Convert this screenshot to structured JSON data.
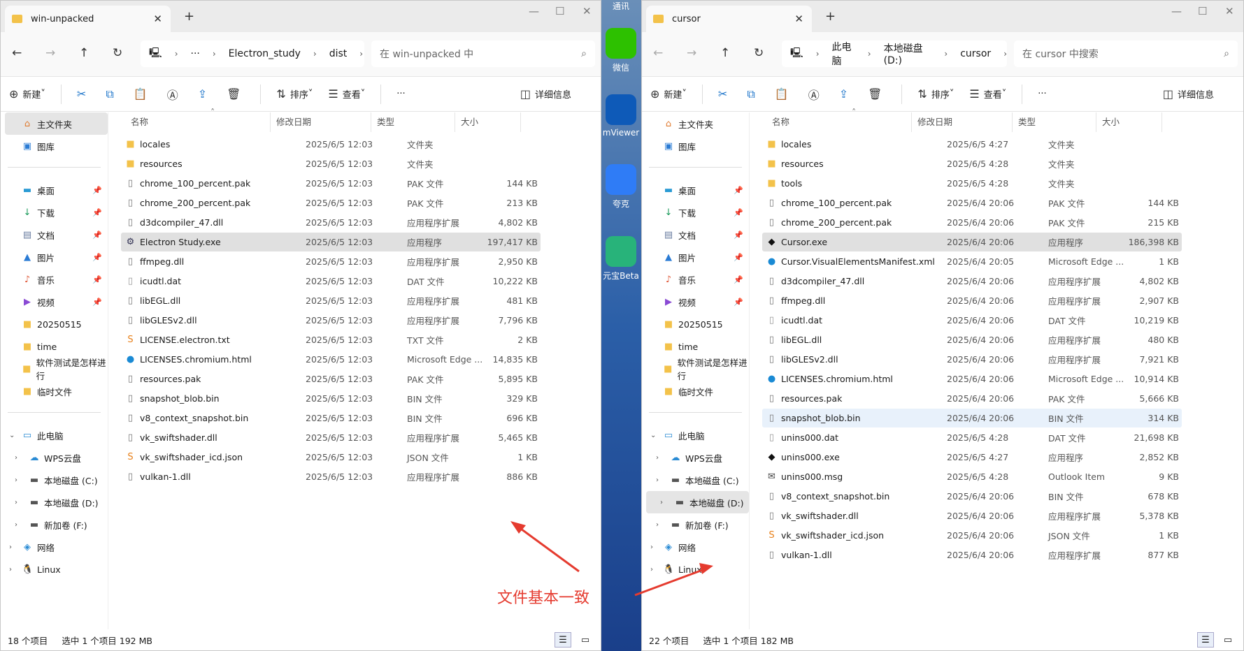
{
  "desktop": {
    "icons": [
      {
        "label": "微信",
        "name": "wechat-icon",
        "color": "#2dc100"
      },
      {
        "label": "mViewer",
        "name": "teamviewer-icon",
        "color": "#0e5ab8"
      },
      {
        "label": "夸克",
        "name": "quark-icon",
        "color": "#2f7cf6"
      },
      {
        "label": "元宝Beta",
        "name": "yuanbao-icon",
        "color": "#28b37a"
      }
    ],
    "top_text": "通讯"
  },
  "annotation": {
    "text": "文件基本一致",
    "color": "#e53b2f"
  },
  "windows": [
    {
      "tab_title": "win-unpacked",
      "breadcrumbs": [
        "···",
        "Electron_study",
        "dist",
        "win-unpacked"
      ],
      "search_placeholder": "在 win-unpacked 中",
      "selected_sidebar": "主文件夹",
      "files": [
        [
          "folder",
          "locales",
          "2025/6/5 12:03",
          "文件夹",
          ""
        ],
        [
          "folder",
          "resources",
          "2025/6/5 12:03",
          "文件夹",
          ""
        ],
        [
          "file",
          "chrome_100_percent.pak",
          "2025/6/5 12:03",
          "PAK 文件",
          "144 KB"
        ],
        [
          "file",
          "chrome_200_percent.pak",
          "2025/6/5 12:03",
          "PAK 文件",
          "213 KB"
        ],
        [
          "dll",
          "d3dcompiler_47.dll",
          "2025/6/5 12:03",
          "应用程序扩展",
          "4,802 KB"
        ],
        [
          "exe",
          "Electron Study.exe",
          "2025/6/5 12:03",
          "应用程序",
          "197,417 KB"
        ],
        [
          "dll",
          "ffmpeg.dll",
          "2025/6/5 12:03",
          "应用程序扩展",
          "2,950 KB"
        ],
        [
          "dat",
          "icudtl.dat",
          "2025/6/5 12:03",
          "DAT 文件",
          "10,222 KB"
        ],
        [
          "dll",
          "libEGL.dll",
          "2025/6/5 12:03",
          "应用程序扩展",
          "481 KB"
        ],
        [
          "dll",
          "libGLESv2.dll",
          "2025/6/5 12:03",
          "应用程序扩展",
          "7,796 KB"
        ],
        [
          "sublime",
          "LICENSE.electron.txt",
          "2025/6/5 12:03",
          "TXT 文件",
          "2 KB"
        ],
        [
          "edge",
          "LICENSES.chromium.html",
          "2025/6/5 12:03",
          "Microsoft Edge ...",
          "14,835 KB"
        ],
        [
          "file",
          "resources.pak",
          "2025/6/5 12:03",
          "PAK 文件",
          "5,895 KB"
        ],
        [
          "file",
          "snapshot_blob.bin",
          "2025/6/5 12:03",
          "BIN 文件",
          "329 KB"
        ],
        [
          "file",
          "v8_context_snapshot.bin",
          "2025/6/5 12:03",
          "BIN 文件",
          "696 KB"
        ],
        [
          "dll",
          "vk_swiftshader.dll",
          "2025/6/5 12:03",
          "应用程序扩展",
          "5,465 KB"
        ],
        [
          "sublime",
          "vk_swiftshader_icd.json",
          "2025/6/5 12:03",
          "JSON 文件",
          "1 KB"
        ],
        [
          "dll",
          "vulkan-1.dll",
          "2025/6/5 12:03",
          "应用程序扩展",
          "886 KB"
        ]
      ],
      "selected_row": 5,
      "hover_row": -1,
      "status": [
        "18 个项目",
        "选中 1 个项目  192 MB"
      ]
    },
    {
      "tab_title": "cursor",
      "breadcrumbs": [
        "此电脑",
        "本地磁盘 (D:)",
        "cursor"
      ],
      "search_placeholder": "在 cursor 中搜索",
      "selected_sidebar": "本地磁盘 (D:)",
      "files": [
        [
          "folder",
          "locales",
          "2025/6/5 4:27",
          "文件夹",
          ""
        ],
        [
          "folder",
          "resources",
          "2025/6/5 4:28",
          "文件夹",
          ""
        ],
        [
          "folder",
          "tools",
          "2025/6/5 4:28",
          "文件夹",
          ""
        ],
        [
          "file",
          "chrome_100_percent.pak",
          "2025/6/4 20:06",
          "PAK 文件",
          "144 KB"
        ],
        [
          "file",
          "chrome_200_percent.pak",
          "2025/6/4 20:06",
          "PAK 文件",
          "215 KB"
        ],
        [
          "cursor",
          "Cursor.exe",
          "2025/6/4 20:06",
          "应用程序",
          "186,398 KB"
        ],
        [
          "edge",
          "Cursor.VisualElementsManifest.xml",
          "2025/6/4 20:05",
          "Microsoft Edge ...",
          "1 KB"
        ],
        [
          "dll",
          "d3dcompiler_47.dll",
          "2025/6/4 20:06",
          "应用程序扩展",
          "4,802 KB"
        ],
        [
          "dll",
          "ffmpeg.dll",
          "2025/6/4 20:06",
          "应用程序扩展",
          "2,907 KB"
        ],
        [
          "dat",
          "icudtl.dat",
          "2025/6/4 20:06",
          "DAT 文件",
          "10,219 KB"
        ],
        [
          "dll",
          "libEGL.dll",
          "2025/6/4 20:06",
          "应用程序扩展",
          "480 KB"
        ],
        [
          "dll",
          "libGLESv2.dll",
          "2025/6/4 20:06",
          "应用程序扩展",
          "7,921 KB"
        ],
        [
          "edge",
          "LICENSES.chromium.html",
          "2025/6/4 20:06",
          "Microsoft Edge ...",
          "10,914 KB"
        ],
        [
          "file",
          "resources.pak",
          "2025/6/4 20:06",
          "PAK 文件",
          "5,666 KB"
        ],
        [
          "file",
          "snapshot_blob.bin",
          "2025/6/4 20:06",
          "BIN 文件",
          "314 KB"
        ],
        [
          "dat",
          "unins000.dat",
          "2025/6/5 4:28",
          "DAT 文件",
          "21,698 KB"
        ],
        [
          "cursor",
          "unins000.exe",
          "2025/6/5 4:27",
          "应用程序",
          "2,852 KB"
        ],
        [
          "mail",
          "unins000.msg",
          "2025/6/5 4:28",
          "Outlook Item",
          "9 KB"
        ],
        [
          "file",
          "v8_context_snapshot.bin",
          "2025/6/4 20:06",
          "BIN 文件",
          "678 KB"
        ],
        [
          "dll",
          "vk_swiftshader.dll",
          "2025/6/4 20:06",
          "应用程序扩展",
          "5,378 KB"
        ],
        [
          "sublime",
          "vk_swiftshader_icd.json",
          "2025/6/4 20:06",
          "JSON 文件",
          "1 KB"
        ],
        [
          "dll",
          "vulkan-1.dll",
          "2025/6/4 20:06",
          "应用程序扩展",
          "877 KB"
        ]
      ],
      "selected_row": 5,
      "hover_row": 14,
      "status": [
        "22 个项目",
        "选中 1 个项目  182 MB"
      ]
    }
  ],
  "toolbar": {
    "new": "新建",
    "sort": "排序",
    "view": "查看",
    "more": "···",
    "details": "详细信息"
  },
  "columns": [
    "名称",
    "修改日期",
    "类型",
    "大小"
  ],
  "sidebar": [
    {
      "label": "主文件夹",
      "icon": "home"
    },
    {
      "label": "图库",
      "icon": "gallery"
    },
    {
      "divider": true
    },
    {
      "label": "桌面",
      "icon": "desktop",
      "pin": true
    },
    {
      "label": "下载",
      "icon": "download",
      "pin": true
    },
    {
      "label": "文档",
      "icon": "documents",
      "pin": true
    },
    {
      "label": "图片",
      "icon": "pictures",
      "pin": true
    },
    {
      "label": "音乐",
      "icon": "music",
      "pin": true
    },
    {
      "label": "视频",
      "icon": "videos",
      "pin": true
    },
    {
      "label": "20250515",
      "icon": "folder"
    },
    {
      "label": "time",
      "icon": "folder"
    },
    {
      "label": "软件测试是怎样进行",
      "icon": "folder"
    },
    {
      "label": "临时文件",
      "icon": "folder"
    },
    {
      "divider": true
    },
    {
      "label": "此电脑",
      "icon": "this-pc",
      "expand": "open"
    },
    {
      "label": "WPS云盘",
      "icon": "cloud",
      "expand": "closed",
      "indent": true
    },
    {
      "label": "本地磁盘 (C:)",
      "icon": "drive",
      "expand": "closed",
      "indent": true
    },
    {
      "label": "本地磁盘 (D:)",
      "icon": "drive",
      "expand": "closed",
      "indent": true
    },
    {
      "label": "新加卷 (F:)",
      "icon": "drive",
      "expand": "closed",
      "indent": true
    },
    {
      "label": "网络",
      "icon": "network",
      "expand": "closed"
    },
    {
      "label": "Linux",
      "icon": "linux",
      "expand": "closed"
    }
  ]
}
